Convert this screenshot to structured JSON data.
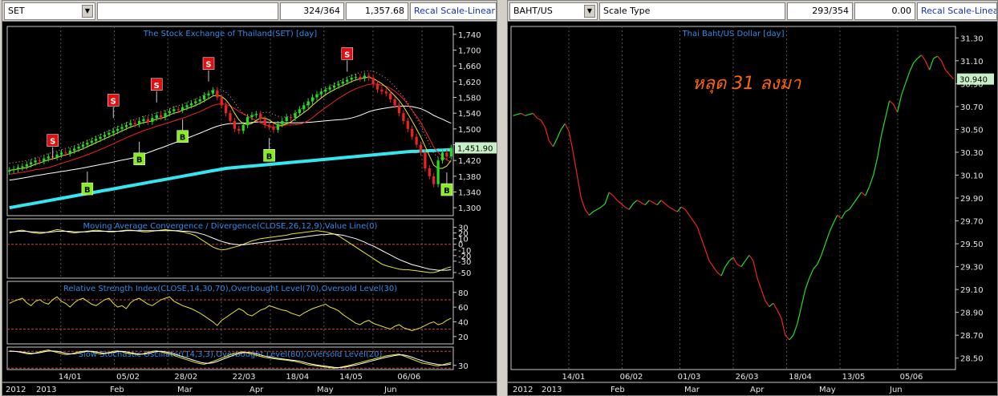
{
  "left_pane": {
    "symbol": "SET",
    "counter": "324/364",
    "value": "1,357.68",
    "recal_label": "Recal Scale-Linear"
  },
  "right_pane": {
    "symbol": "BAHT/US",
    "scale_label": "Scale Type",
    "counter": "293/354",
    "value": "0.00",
    "recal_label": "Recal Scale-Linear",
    "annotation": "หลุด 31 ลงมา"
  },
  "colors": {
    "up": "#22dd22",
    "down": "#ee2222",
    "ma_long": "#33e6f0",
    "signal_sell": "#e01010",
    "signal_buy": "#88ee22",
    "osc_line": "#e6e62a",
    "title_blue": "#2e8ce6",
    "annotation": "#ff6600"
  },
  "chart_data": [
    {
      "type": "candlestick",
      "title": "The Stock Exchange of Thailand(SET) [day]",
      "ylim": [
        1280,
        1760
      ],
      "yticks": [
        "1,740",
        "1,700",
        "1,660",
        "1,620",
        "1,580",
        "1,540",
        "1,500",
        "1,460",
        "1,420",
        "1,380",
        "1,340",
        "1,300"
      ],
      "last_value_label": "1,451.90",
      "last_value": 1451.9,
      "x_dates": [
        "14/01",
        "05/02",
        "28/02",
        "22/03",
        "18/04",
        "14/05",
        "06/06"
      ],
      "month_labels": [
        "2012",
        "2013",
        "Feb",
        "Mar",
        "Apr",
        "May",
        "Jun"
      ],
      "close": [
        1395,
        1398,
        1402,
        1405,
        1410,
        1415,
        1420,
        1418,
        1425,
        1430,
        1428,
        1435,
        1440,
        1438,
        1445,
        1450,
        1455,
        1460,
        1465,
        1470,
        1475,
        1480,
        1485,
        1490,
        1495,
        1500,
        1505,
        1510,
        1515,
        1512,
        1520,
        1525,
        1518,
        1528,
        1535,
        1530,
        1540,
        1545,
        1550,
        1548,
        1555,
        1560,
        1565,
        1570,
        1575,
        1585,
        1590,
        1598,
        1580,
        1560,
        1540,
        1520,
        1500,
        1495,
        1510,
        1530,
        1535,
        1538,
        1525,
        1510,
        1505,
        1498,
        1512,
        1520,
        1530,
        1528,
        1540,
        1550,
        1560,
        1570,
        1580,
        1588,
        1595,
        1600,
        1605,
        1610,
        1615,
        1620,
        1625,
        1630,
        1632,
        1628,
        1635,
        1630,
        1615,
        1600,
        1595,
        1590,
        1575,
        1560,
        1540,
        1520,
        1500,
        1480,
        1460,
        1440,
        1400,
        1380,
        1360,
        1420,
        1440,
        1430,
        1452
      ],
      "signals": [
        {
          "type": "sell",
          "label": "S",
          "index": 10,
          "value": 1470
        },
        {
          "type": "sell",
          "label": "S",
          "index": 24,
          "value": 1572
        },
        {
          "type": "sell",
          "label": "S",
          "index": 34,
          "value": 1612
        },
        {
          "type": "sell",
          "label": "S",
          "index": 46,
          "value": 1665
        },
        {
          "type": "sell",
          "label": "S",
          "index": 78,
          "value": 1690
        },
        {
          "type": "buy",
          "label": "B",
          "index": 18,
          "value": 1347
        },
        {
          "type": "buy",
          "label": "B",
          "index": 30,
          "value": 1423
        },
        {
          "type": "buy",
          "label": "B",
          "index": 40,
          "value": 1480
        },
        {
          "type": "buy",
          "label": "B",
          "index": 60,
          "value": 1432
        },
        {
          "type": "buy",
          "label": "B",
          "index": 101,
          "value": 1345
        }
      ],
      "ma_long": [
        1300,
        1302,
        1304,
        1306,
        1308,
        1310,
        1312,
        1314,
        1316,
        1318,
        1320,
        1322,
        1324,
        1326,
        1328,
        1330,
        1332,
        1334,
        1336,
        1338,
        1340,
        1342,
        1344,
        1346,
        1348,
        1350,
        1352,
        1354,
        1356,
        1358,
        1360,
        1362,
        1364,
        1366,
        1368,
        1370,
        1372,
        1374,
        1376,
        1378,
        1380,
        1382,
        1384,
        1386,
        1388,
        1390,
        1392,
        1394,
        1396,
        1398,
        1400,
        1401,
        1402,
        1403,
        1404,
        1405,
        1406,
        1407,
        1408,
        1409,
        1410,
        1411,
        1412,
        1413,
        1414,
        1415,
        1416,
        1417,
        1418,
        1419,
        1420,
        1421,
        1422,
        1423,
        1424,
        1425,
        1426,
        1427,
        1428,
        1429,
        1430,
        1431,
        1432,
        1433,
        1434,
        1435,
        1436,
        1437,
        1438,
        1439,
        1440,
        1441,
        1442,
        1443,
        1443,
        1444,
        1444,
        1445,
        1445,
        1446,
        1446,
        1447,
        1447
      ]
    },
    {
      "type": "line",
      "title": "Moving Average Convergence / Divergence(CLOSE,26,12,9),Value Line(0)",
      "ylim": [
        -60,
        45
      ],
      "yticks": [
        "30",
        "20",
        "10",
        "0",
        "-10",
        "-20",
        "-30",
        "-50"
      ],
      "series": [
        {
          "values": [
            20,
            22,
            24,
            25,
            23,
            21,
            20,
            19,
            20,
            22,
            24,
            26,
            25,
            23,
            21,
            20,
            21,
            22,
            23,
            24,
            25,
            24,
            23,
            22,
            22,
            23,
            24,
            25,
            25,
            24,
            23,
            22,
            22,
            23,
            24,
            25,
            26,
            25,
            24,
            23,
            22,
            20,
            18,
            15,
            10,
            5,
            0,
            -5,
            -8,
            -10,
            -9,
            -7,
            -5,
            -3,
            0,
            3,
            6,
            8,
            10,
            11,
            12,
            13,
            14,
            15,
            16,
            18,
            19,
            20,
            21,
            22,
            23,
            24,
            23,
            22,
            20,
            18,
            15,
            10,
            5,
            0,
            -5,
            -10,
            -15,
            -20,
            -25,
            -30,
            -35,
            -38,
            -40,
            -42,
            -44,
            -45,
            -45,
            -46,
            -47,
            -48,
            -49,
            -50,
            -50,
            -48,
            -45,
            -42,
            -40
          ]
        },
        {
          "values": [
            22,
            22,
            23,
            23,
            23,
            22,
            22,
            21,
            21,
            21,
            22,
            23,
            23,
            23,
            23,
            22,
            22,
            22,
            22,
            23,
            23,
            23,
            23,
            23,
            23,
            23,
            23,
            24,
            24,
            24,
            24,
            24,
            24,
            24,
            24,
            24,
            24,
            24,
            24,
            24,
            23,
            23,
            22,
            21,
            19,
            17,
            14,
            11,
            8,
            5,
            3,
            1,
            0,
            -1,
            -1,
            0,
            1,
            2,
            3,
            4,
            5,
            6,
            7,
            8,
            9,
            10,
            11,
            12,
            13,
            14,
            15,
            16,
            17,
            17,
            18,
            18,
            17,
            16,
            14,
            12,
            10,
            7,
            4,
            0,
            -3,
            -7,
            -11,
            -15,
            -19,
            -23,
            -27,
            -30,
            -33,
            -36,
            -38,
            -40,
            -42,
            -44,
            -45,
            -46,
            -46,
            -46,
            -45
          ]
        }
      ]
    },
    {
      "type": "line",
      "title": "Relative Strength Index(CLOSE,14,30,70),Overbought Level(70),Oversold Level(30)",
      "ylim": [
        10,
        95
      ],
      "yticks": [
        "80",
        "60",
        "40",
        "20"
      ],
      "levels": [
        70,
        30
      ],
      "series": [
        {
          "values": [
            65,
            68,
            70,
            72,
            66,
            62,
            68,
            70,
            66,
            64,
            70,
            74,
            68,
            65,
            60,
            66,
            70,
            72,
            68,
            64,
            62,
            66,
            70,
            72,
            65,
            60,
            62,
            58,
            66,
            70,
            72,
            68,
            64,
            62,
            66,
            70,
            72,
            74,
            68,
            65,
            62,
            60,
            58,
            55,
            52,
            48,
            44,
            40,
            35,
            42,
            46,
            50,
            54,
            58,
            55,
            50,
            48,
            52,
            56,
            58,
            62,
            60,
            58,
            56,
            55,
            52,
            50,
            48,
            52,
            55,
            58,
            60,
            62,
            64,
            60,
            58,
            55,
            50,
            46,
            42,
            38,
            36,
            40,
            42,
            38,
            36,
            34,
            32,
            30,
            34,
            36,
            32,
            30,
            28,
            30,
            32,
            35,
            38,
            40,
            36,
            38,
            42,
            45
          ]
        }
      ]
    },
    {
      "type": "line",
      "title": "Slow Stochastic Oscillator(14,3,3),Overbought Level(80),Oversold Level(20)",
      "ylim": [
        15,
        95
      ],
      "yticks": [
        "30"
      ],
      "levels": [
        80,
        20
      ],
      "series": [
        {
          "values": [
            82,
            80,
            78,
            75,
            72,
            70,
            74,
            78,
            82,
            85,
            80,
            76,
            72,
            68,
            70,
            74,
            78,
            80,
            82,
            78,
            74,
            70,
            72,
            76,
            80,
            82,
            78,
            74,
            72,
            70,
            68,
            72,
            76,
            80,
            82,
            78,
            74,
            70,
            66,
            60,
            55,
            50,
            45,
            40,
            36,
            34,
            38,
            44,
            50,
            56,
            62,
            68,
            72,
            76,
            78,
            74,
            70,
            66,
            62,
            58,
            56,
            54,
            52,
            50,
            48,
            46,
            44,
            40,
            36,
            32,
            30,
            28,
            26,
            24,
            22,
            20,
            22,
            25,
            28,
            32,
            36,
            40,
            44,
            48,
            52,
            56,
            60,
            64,
            66,
            68,
            70,
            64,
            58,
            52,
            46,
            40,
            36,
            34,
            30,
            28,
            32,
            36,
            40
          ]
        },
        {
          "values": [
            80,
            80,
            79,
            77,
            75,
            73,
            73,
            75,
            78,
            81,
            81,
            80,
            77,
            73,
            71,
            71,
            74,
            77,
            80,
            80,
            78,
            75,
            73,
            74,
            76,
            79,
            80,
            78,
            75,
            72,
            70,
            70,
            72,
            76,
            79,
            80,
            78,
            75,
            71,
            66,
            61,
            56,
            51,
            46,
            41,
            38,
            37,
            39,
            44,
            50,
            56,
            62,
            67,
            72,
            75,
            76,
            75,
            71,
            67,
            63,
            60,
            57,
            55,
            53,
            51,
            49,
            47,
            45,
            41,
            37,
            34,
            31,
            29,
            27,
            25,
            23,
            22,
            23,
            25,
            28,
            31,
            35,
            39,
            43,
            47,
            51,
            55,
            59,
            62,
            65,
            67,
            67,
            64,
            59,
            53,
            48,
            43,
            39,
            36,
            33,
            31,
            32,
            35
          ]
        }
      ]
    },
    {
      "type": "line",
      "title": "Thai Baht/US Dollar [day]",
      "ylim": [
        28.4,
        31.4
      ],
      "yticks": [
        "31.30",
        "31.10",
        "30.90",
        "30.70",
        "30.50",
        "30.30",
        "30.10",
        "29.90",
        "29.70",
        "29.50",
        "29.30",
        "29.10",
        "28.90",
        "28.70",
        "28.50"
      ],
      "last_value_label": "30.940",
      "last_value": 30.94,
      "x_dates": [
        "14/01",
        "06/02",
        "01/03",
        "26/03",
        "18/04",
        "13/05",
        "05/06"
      ],
      "month_labels": [
        "2012",
        "2013",
        "Feb",
        "Mar",
        "Apr",
        "May",
        "Jun"
      ],
      "series": [
        {
          "values": [
            30.62,
            30.63,
            30.64,
            30.62,
            30.63,
            30.64,
            30.6,
            30.58,
            30.52,
            30.4,
            30.35,
            30.42,
            30.5,
            30.55,
            30.48,
            30.3,
            30.1,
            29.9,
            29.8,
            29.75,
            29.78,
            29.8,
            29.82,
            29.85,
            29.95,
            29.92,
            29.88,
            29.85,
            29.82,
            29.8,
            29.85,
            29.88,
            29.86,
            29.84,
            29.88,
            29.86,
            29.84,
            29.88,
            29.85,
            29.82,
            29.8,
            29.78,
            29.82,
            29.8,
            29.75,
            29.7,
            29.65,
            29.55,
            29.45,
            29.35,
            29.3,
            29.25,
            29.22,
            29.3,
            29.35,
            29.38,
            29.32,
            29.3,
            29.35,
            29.4,
            29.35,
            29.2,
            29.1,
            29.0,
            28.95,
            28.98,
            28.92,
            28.85,
            28.7,
            28.66,
            28.7,
            28.8,
            28.95,
            29.1,
            29.2,
            29.28,
            29.32,
            29.4,
            29.5,
            29.6,
            29.68,
            29.75,
            29.72,
            29.78,
            29.8,
            29.85,
            29.9,
            29.95,
            29.92,
            30.0,
            30.1,
            30.25,
            30.45,
            30.6,
            30.75,
            30.72,
            30.65,
            30.8,
            30.9,
            31.0,
            31.08,
            31.12,
            31.15,
            31.1,
            31.02,
            31.12,
            31.14,
            31.1,
            31.02,
            30.98,
            30.94
          ]
        }
      ]
    }
  ]
}
